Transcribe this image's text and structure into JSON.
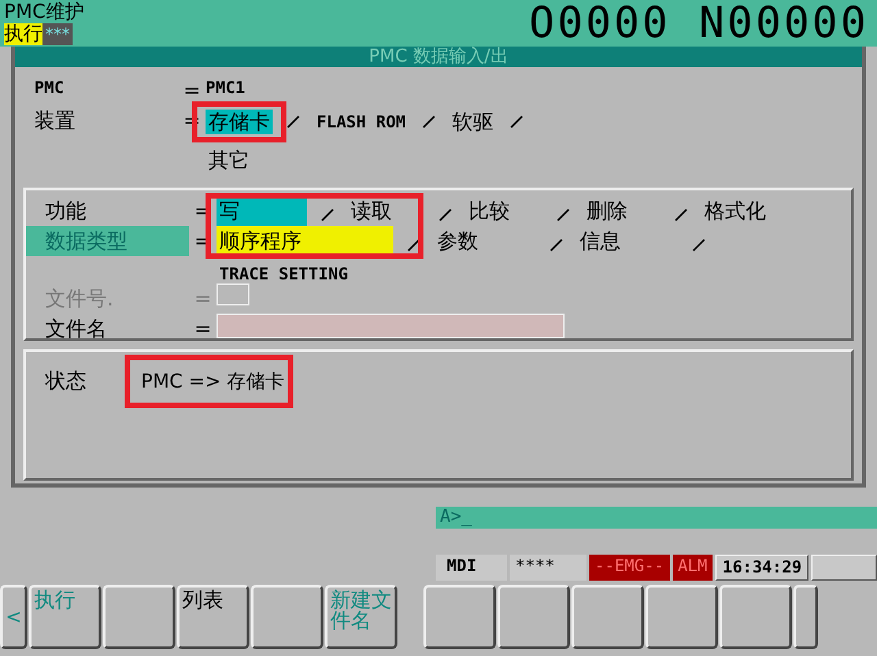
{
  "header": {
    "screen": "PMC维护",
    "mode": "执行",
    "mode_stars": "***",
    "program": "O0000 N00000"
  },
  "title": "PMC 数据输入/出",
  "pmc": {
    "label": "PMC",
    "eq": "=",
    "value": "PMC1"
  },
  "device": {
    "label": "装置",
    "eq": "=",
    "focused": false,
    "highlighted": true,
    "options": [
      {
        "label": "存储卡",
        "selected": true
      },
      {
        "label": "FLASH ROM",
        "selected": false
      },
      {
        "label": "软驱",
        "selected": false
      },
      {
        "label": "其它",
        "selected": false
      }
    ]
  },
  "function": {
    "label": "功能",
    "eq": "=",
    "focused": false,
    "highlighted": true,
    "options": [
      {
        "label": "写",
        "selected": true
      },
      {
        "label": "读取",
        "selected": false
      },
      {
        "label": "比较",
        "selected": false
      },
      {
        "label": "删除",
        "selected": false
      },
      {
        "label": "格式化",
        "selected": false
      }
    ]
  },
  "data_type": {
    "label": "数据类型",
    "eq": "=",
    "focused": true,
    "options": [
      {
        "label": "顺序程序",
        "selected": true
      },
      {
        "label": "参数",
        "selected": false
      },
      {
        "label": "信息",
        "selected": false
      },
      {
        "label": "TRACE SETTING",
        "selected": false
      }
    ]
  },
  "file_number": {
    "label": "文件号.",
    "eq": "=",
    "disabled": true
  },
  "file_name": {
    "label": "文件名",
    "eq": "=",
    "disabled": false
  },
  "status": {
    "label": "状态",
    "value": "PMC => 存储卡",
    "highlighted": true
  },
  "input_line": {
    "prompt": "A>_"
  },
  "status_bar": [
    {
      "text": "MDI",
      "kind": "plain"
    },
    {
      "text": "****",
      "kind": "plain"
    },
    {
      "text": "--EMG--",
      "kind": "alarm"
    },
    {
      "text": "ALM",
      "kind": "alarm"
    },
    {
      "text": "16:34:29",
      "kind": "box"
    },
    {
      "kind": "box"
    }
  ],
  "softkeys": {
    "prev": "<",
    "keys": [
      {
        "kind": "label",
        "label": "执行",
        "color": "#108a80"
      },
      {
        "kind": "blank"
      },
      {
        "kind": "label",
        "label": "列表",
        "color": "#000000"
      },
      {
        "kind": "blank"
      },
      {
        "kind": "label",
        "label": "新建文件名",
        "color": "#108a80"
      },
      {
        "kind": "blank"
      },
      {
        "kind": "blank"
      },
      {
        "kind": "blank"
      },
      {
        "kind": "blank"
      },
      {
        "kind": "blank"
      }
    ]
  }
}
